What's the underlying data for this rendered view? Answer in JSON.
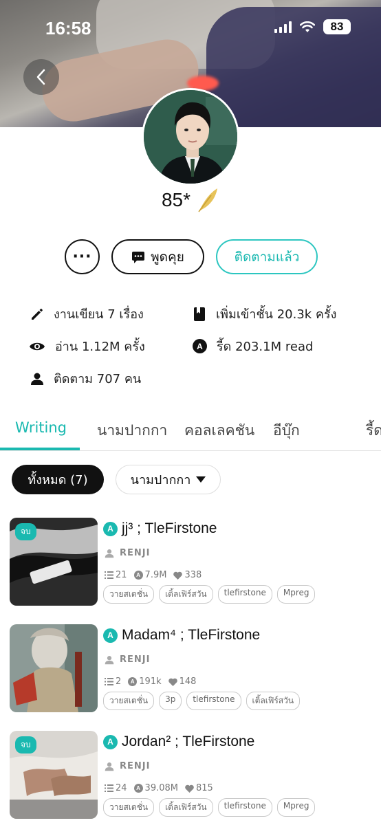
{
  "status": {
    "time": "16:58",
    "battery": "83"
  },
  "profile": {
    "name": "85*"
  },
  "actions": {
    "more_label": "···",
    "chat_label": "พูดคุย",
    "follow_label": "ติดตามแล้ว"
  },
  "stats": {
    "works": "งานเขียน 7 เรื่อง",
    "added_to_shelf": "เพิ่มเข้าชั้น 20.3k ครั้ง",
    "reads": "อ่าน 1.12M ครั้ง",
    "reads_count": "รี้ด 203.1M read",
    "followers": "ติดตาม 707 คน"
  },
  "tabs": [
    "Writing",
    "นามปากกา",
    "คอลเลคชัน",
    "อีบุ๊ก",
    "รี้ด"
  ],
  "filters": {
    "all_label": "ทั้งหมด (7)",
    "pen_name_label": "นามปากกา"
  },
  "stories": [
    {
      "badge": "จบ",
      "title": "jj³ ; TleFirstone",
      "author": "RENJI",
      "chapters": "21",
      "reads": "7.9M",
      "likes": "338",
      "tags": [
        "วายสเตชั่น",
        "เติ้ลเฟิร์สวัน",
        "tlefirstone",
        "Mpreg"
      ]
    },
    {
      "badge": "",
      "title": "Madam⁴ ; TleFirstone",
      "author": "RENJI",
      "chapters": "2",
      "reads": "191k",
      "likes": "148",
      "tags": [
        "วายสเตชั่น",
        "3p",
        "tlefirstone",
        "เติ้ลเฟิร์สวัน"
      ]
    },
    {
      "badge": "จบ",
      "title": "Jordan² ; TleFirstone",
      "author": "RENJI",
      "chapters": "24",
      "reads": "39.08M",
      "likes": "815",
      "tags": [
        "วายสเตชั่น",
        "เติ้ลเฟิร์สวัน",
        "tlefirstone",
        "Mpreg"
      ]
    }
  ],
  "colors": {
    "accent": "#1ab9b0",
    "dark": "#111111"
  },
  "icons": {
    "back": "chevron-left-icon",
    "chat": "chat-bubble-icon",
    "works": "pencil-icon",
    "shelf": "bookmark-book-icon",
    "reads": "eye-icon",
    "reads_count": "readawrite-icon",
    "followers": "person-icon",
    "quill": "gold-quill-icon"
  }
}
